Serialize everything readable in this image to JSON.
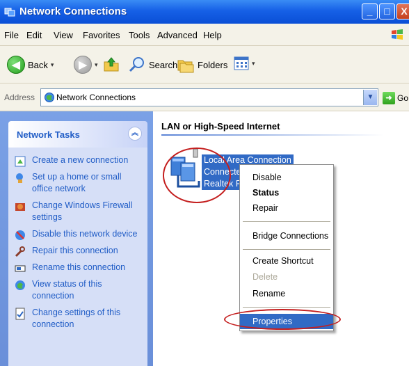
{
  "window": {
    "title": "Network Connections",
    "minimize": "_",
    "maximize": "□",
    "close": "X"
  },
  "menu": [
    "File",
    "Edit",
    "View",
    "Favorites",
    "Tools",
    "Advanced",
    "Help"
  ],
  "toolbar": {
    "back": "Back",
    "search": "Search",
    "folders": "Folders"
  },
  "address": {
    "label": "Address",
    "value": "Network Connections",
    "go": "Go"
  },
  "tasks": {
    "title": "Network Tasks",
    "items": [
      "Create a new connection",
      "Set up a home or small office network",
      "Change Windows Firewall settings",
      "Disable this network device",
      "Repair this connection",
      "Rename this connection",
      "View status of this connection",
      "Change settings of this connection"
    ]
  },
  "content": {
    "group": "LAN or High-Speed Internet",
    "connection": {
      "name": "Local Area Connection",
      "status": "Connected",
      "device": "Realtek RTL"
    }
  },
  "context_menu": {
    "disable": "Disable",
    "status": "Status",
    "repair": "Repair",
    "bridge": "Bridge Connections",
    "shortcut": "Create Shortcut",
    "delete": "Delete",
    "rename": "Rename",
    "properties": "Properties"
  },
  "colors": {
    "title_bar": "#0a4fd6",
    "task_pane": "#6a8fd9",
    "link": "#215dc6",
    "selection": "#316ac5",
    "callout": "#c41e1e"
  }
}
